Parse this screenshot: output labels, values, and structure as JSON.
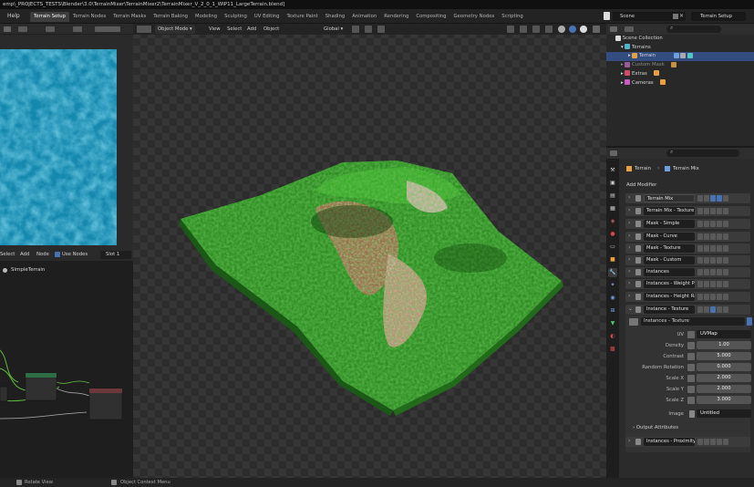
{
  "window": {
    "title": "emp\\_PROJECTS_TESTS\\Blender\\3.0\\TerrainMixer\\TerrainMixer2\\TerrainMixer_V_2_0_1_WIP11_LargeTerrain.blend]"
  },
  "topbar": {
    "menu_help": "Help",
    "workspace_tabs": [
      "Terrain Setup",
      "Terrain Nodes",
      "Terrain Masks",
      "Terrain Baking",
      "Modeling",
      "Sculpting",
      "UV Editing",
      "Texture Paint",
      "Shading",
      "Animation",
      "Rendering",
      "Compositing",
      "Geometry Nodes",
      "Scripting"
    ],
    "active_tab": "Terrain Setup",
    "scene_name": "Scene",
    "view_layer": "Terrain Setup"
  },
  "node_editor": {
    "menu": [
      "Select",
      "Add",
      "Node"
    ],
    "use_nodes_label": "Use Nodes",
    "slot": "Slot 1",
    "material_name": "SimpleTerrain"
  },
  "viewport": {
    "mode": "Object Mode",
    "menus": [
      "View",
      "Select",
      "Add",
      "Object"
    ],
    "transform_orientation": "Global"
  },
  "outliner": {
    "items": [
      {
        "label": "Scene Collection",
        "indent": 0
      },
      {
        "label": "Terrains",
        "indent": 1
      },
      {
        "label": "Terrain",
        "indent": 2,
        "selected": true
      },
      {
        "label": "Custom Mask",
        "indent": 1,
        "dim": true
      },
      {
        "label": "Extras",
        "indent": 1
      },
      {
        "label": "Cameras",
        "indent": 1
      }
    ]
  },
  "properties": {
    "breadcrumb_object": "Terrain",
    "breadcrumb_modifier": "Terrain Mix",
    "add_modifier_label": "Add Modifier",
    "modifiers": [
      "Terrain Mix",
      "Terrain Mix - Texture",
      "Mask - Simple",
      "Mask - Curve",
      "Mask - Texture",
      "Mask - Custom",
      "Instances",
      "Instances - Weight Paint",
      "Instances - Height Range",
      "Instance - Texture"
    ],
    "node_group_name": "Instances - Texture",
    "fields": [
      {
        "label": "UV",
        "value": "UVMap"
      },
      {
        "label": "Density",
        "value": "1.00"
      },
      {
        "label": "Contrast",
        "value": "5.000"
      },
      {
        "label": "Random Rotation",
        "value": "0.000"
      },
      {
        "label": "Scale X",
        "value": "2.000"
      },
      {
        "label": "Scale Y",
        "value": "2.000"
      },
      {
        "label": "Scale Z",
        "value": "3.000"
      },
      {
        "label": "Image",
        "value": "Untitled"
      }
    ],
    "output_attributes_label": "Output Attributes",
    "last_modifier": "Instances - Proximity"
  },
  "statusbar": {
    "left_hint": "Rotate View",
    "right_hint": "Object Context Menu"
  },
  "colors": {
    "accent_blue": "#4772b3",
    "selection_row": "#334d80",
    "terrain_green": "#3fa82a",
    "texture_blue": "#1c8fb4"
  }
}
